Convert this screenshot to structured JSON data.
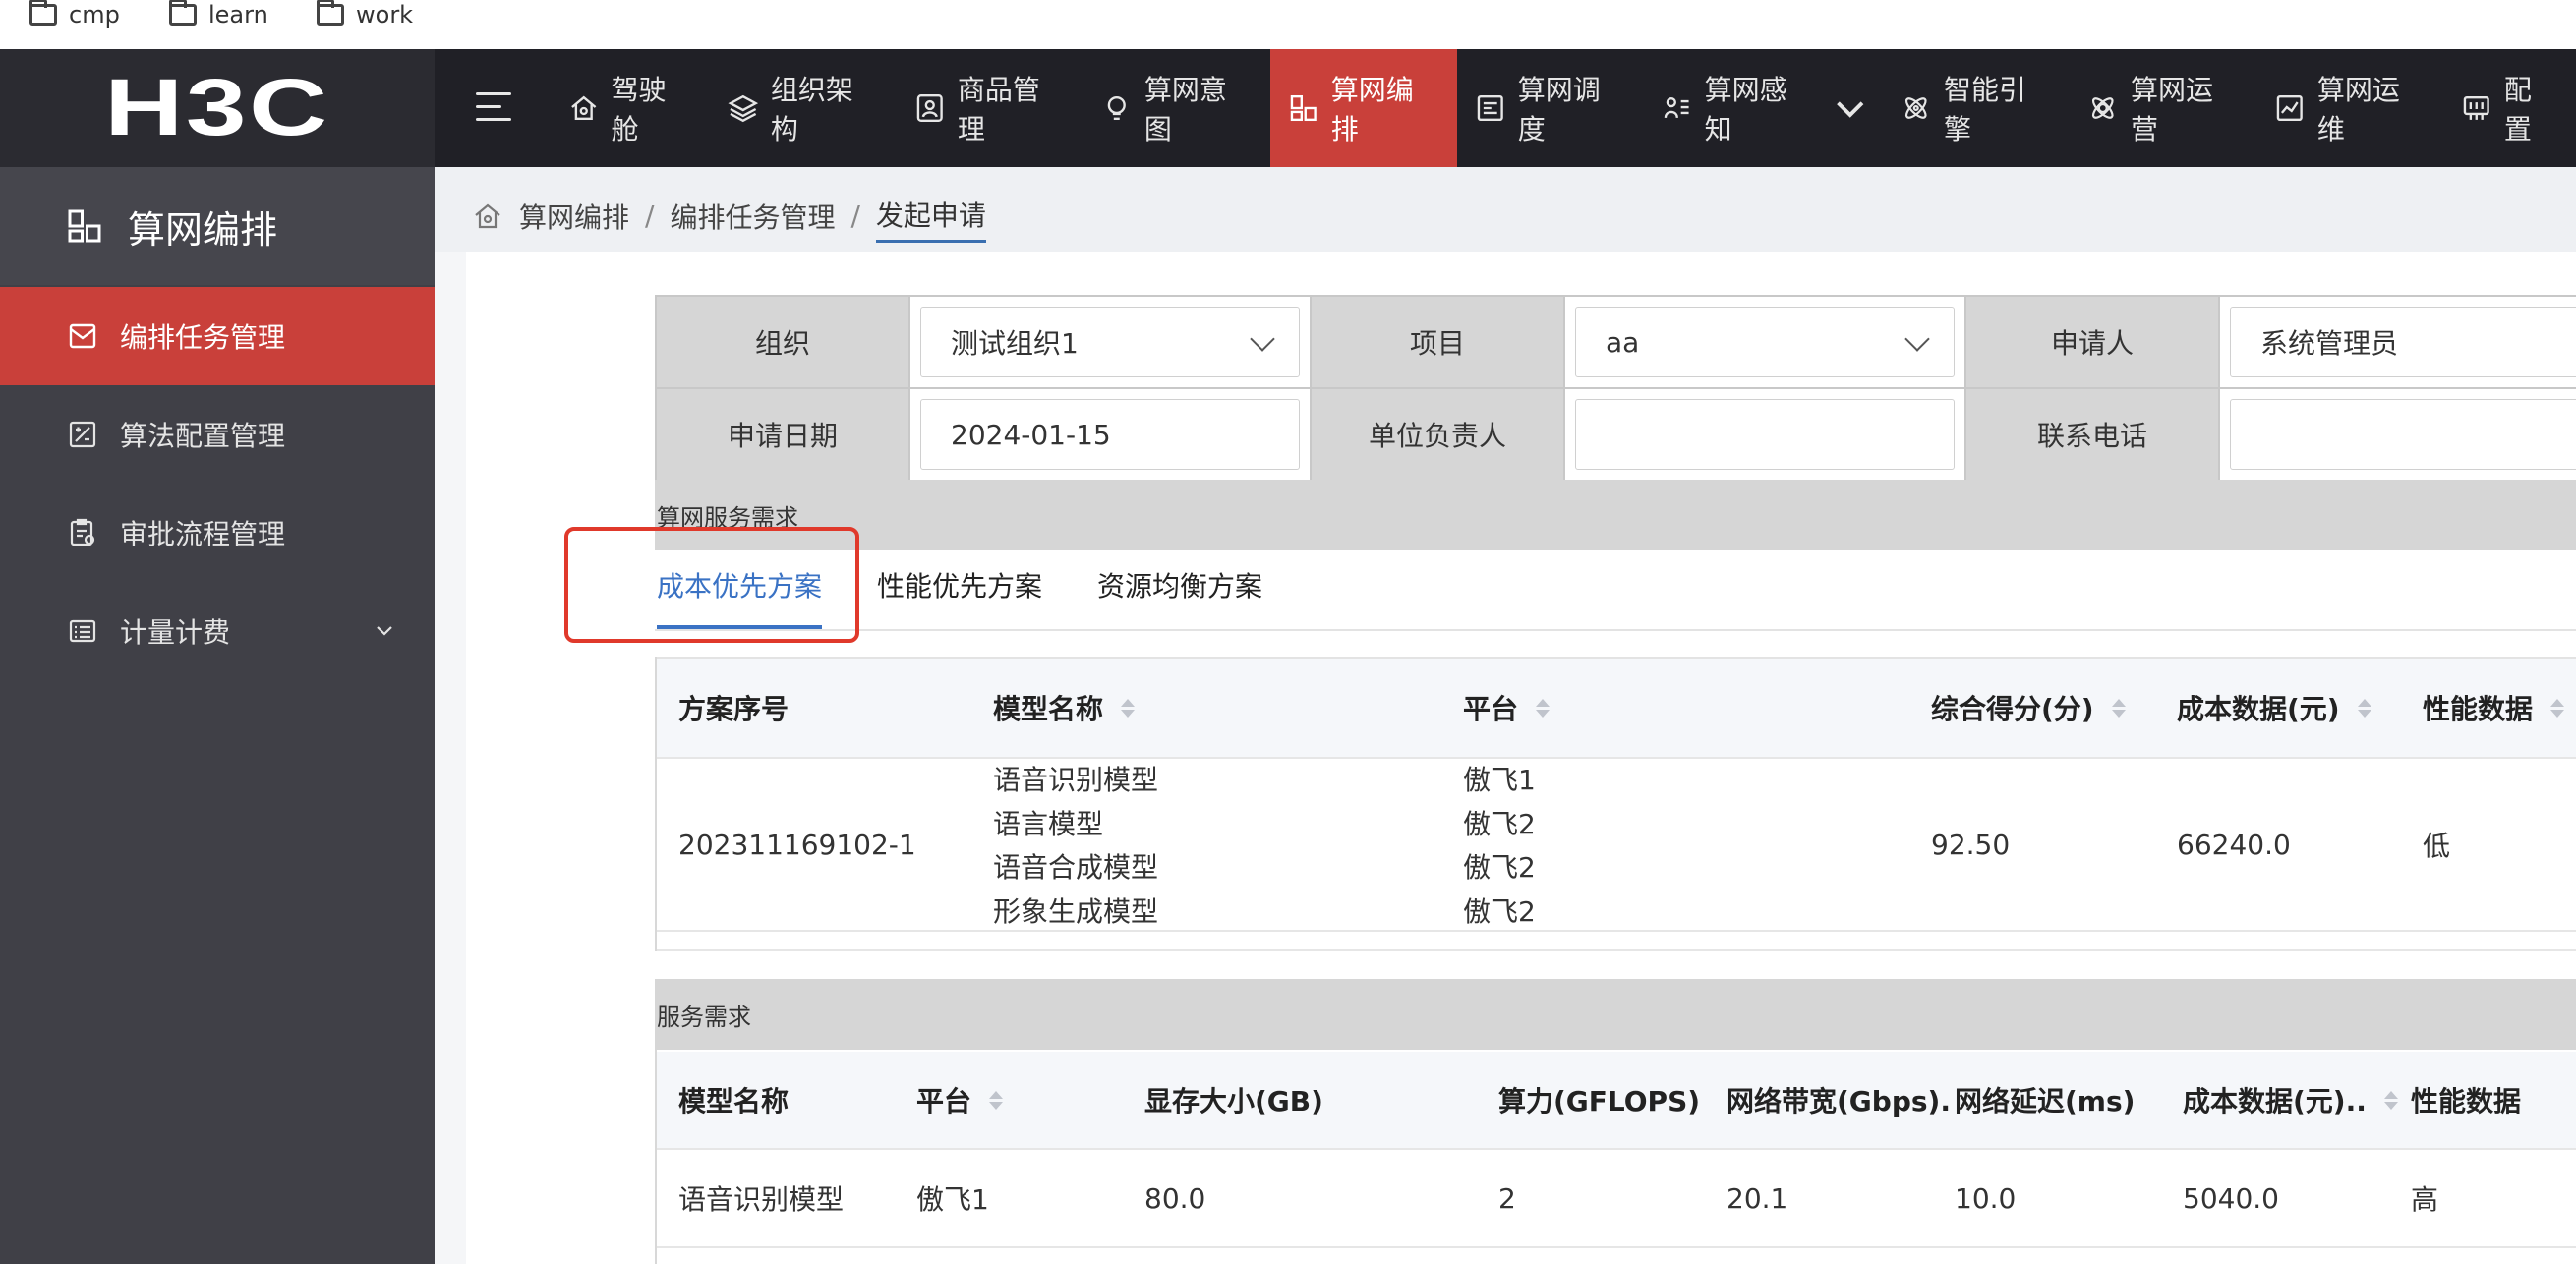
{
  "bookmarks": [
    {
      "label": "cmp"
    },
    {
      "label": "learn"
    },
    {
      "label": "work"
    }
  ],
  "brand": {
    "logo": "H3C",
    "accent": "#c9403a",
    "dark": "#202026"
  },
  "nav": [
    {
      "label": "驾驶舱",
      "icon": "home-icon"
    },
    {
      "label": "组织架构",
      "icon": "layers-icon"
    },
    {
      "label": "商品管理",
      "icon": "user-card-icon"
    },
    {
      "label": "算网意图",
      "icon": "bulb-icon"
    },
    {
      "label": "算网编排",
      "icon": "orchestrate-icon",
      "active": true
    },
    {
      "label": "算网调度",
      "icon": "schedule-icon"
    },
    {
      "label": "算网感知",
      "icon": "sense-icon",
      "dropdown": true
    },
    {
      "label": "智能引擎",
      "icon": "atom-icon"
    },
    {
      "label": "算网运营",
      "icon": "atom2-icon"
    },
    {
      "label": "算网运维",
      "icon": "chart-icon"
    },
    {
      "label": "配置",
      "icon": "config-icon"
    }
  ],
  "sidebar": {
    "title": "算网编排",
    "items": [
      {
        "label": "编排任务管理",
        "active": true
      },
      {
        "label": "算法配置管理"
      },
      {
        "label": "审批流程管理"
      },
      {
        "label": "计量计费",
        "expandable": true
      }
    ]
  },
  "breadcrumb": {
    "items": [
      "算网编排",
      "编排任务管理",
      "发起申请"
    ],
    "sep": "/"
  },
  "form": {
    "org_label": "组织",
    "org_value": "测试组织1",
    "project_label": "项目",
    "project_value": "aa",
    "applicant_label": "申请人",
    "applicant_value": "系统管理员",
    "date_label": "申请日期",
    "date_value": "2024-01-15",
    "owner_label": "单位负责人",
    "owner_value": "",
    "phone_label": "联系电话",
    "phone_value": ""
  },
  "section1": {
    "title": "算网服务需求",
    "tabs": [
      {
        "label": "成本优先方案",
        "active": true
      },
      {
        "label": "性能优先方案"
      },
      {
        "label": "资源均衡方案"
      }
    ],
    "columns": [
      "方案序号",
      "模型名称",
      "平台",
      "综合得分(分)",
      "成本数据(元)",
      "性能数据"
    ],
    "row": {
      "id": "202311169102-1",
      "models": [
        "语音识别模型",
        "语言模型",
        "语音合成模型",
        "形象生成模型"
      ],
      "platforms": [
        "傲飞1",
        "傲飞2",
        "傲飞2",
        "傲飞2"
      ],
      "score": "92.50",
      "cost": "66240.0",
      "perf": "低"
    }
  },
  "section2": {
    "title": "服务需求",
    "columns": [
      "模型名称",
      "平台",
      "显存大小(GB)",
      "算力(GFLOPS)",
      "网络带宽(Gbps).",
      "网络延迟(ms)",
      "成本数据(元)..",
      "性能数据"
    ],
    "row": [
      "语音识别模型",
      "傲飞1",
      "80.0",
      "2",
      "20.1",
      "10.0",
      "5040.0",
      "高"
    ]
  }
}
